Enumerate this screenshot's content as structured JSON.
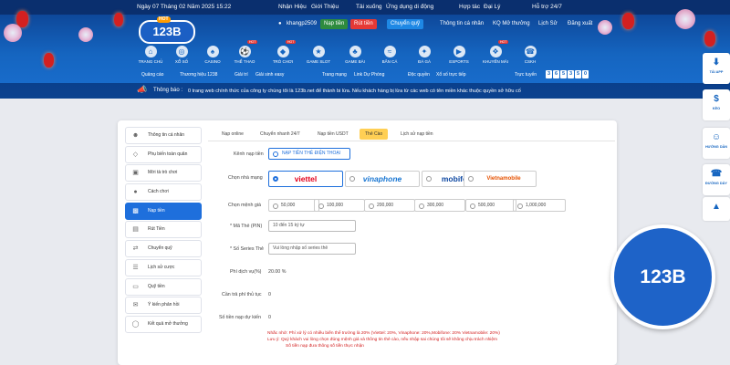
{
  "topbar": {
    "datetime": "Ngày 07 Tháng 02 Năm 2025 15:22",
    "links": [
      "Nhận Hiệu",
      "Giới Thiệu",
      "Tải xuống",
      "Ứng dụng di động",
      "Hợp tác",
      "Đại Lý",
      "Chăm",
      "Hỗ trợ 24/7"
    ]
  },
  "brand": {
    "logo_text": "123B",
    "logo_tag": "HOT"
  },
  "account": {
    "username": "khangp2509",
    "deposit_label": "Nạp tiền",
    "withdraw_label": "Rút tiền",
    "transfer_label": "Chuyển quỹ",
    "links": [
      "Thông tin cá nhân",
      "KQ Mở thưởng",
      "Lịch Sử",
      "Đăng xuất"
    ]
  },
  "nav": {
    "items": [
      {
        "label": "TRANG CHỦ",
        "icon": "home-icon"
      },
      {
        "label": "XỔ SỐ",
        "icon": "lottery-icon"
      },
      {
        "label": "CASINO",
        "icon": "casino-icon"
      },
      {
        "label": "THỂ THAO",
        "icon": "sports-icon",
        "hot": "HOT"
      },
      {
        "label": "TRÒ CHƠI",
        "icon": "game-icon",
        "hot": "HOT"
      },
      {
        "label": "GAME SLOT",
        "icon": "slot-icon"
      },
      {
        "label": "GAME BÀI",
        "icon": "card-icon"
      },
      {
        "label": "BẮN CÁ",
        "icon": "fish-icon"
      },
      {
        "label": "ĐÁ GÀ",
        "icon": "rooster-icon"
      },
      {
        "label": "ESPORTS",
        "icon": "esports-icon"
      },
      {
        "label": "KHUYẾN MÃI",
        "icon": "gift-icon",
        "hot": "HOT"
      },
      {
        "label": "CSKH",
        "icon": "support-icon"
      }
    ]
  },
  "subnav": {
    "items": [
      "Quảng cáo",
      "Thương hiệu 1238",
      "Giải trí",
      "Giải sinh easy",
      "Trang mạng",
      "Link Dự Phòng",
      "Độc quyền",
      "Xổ số trực tiếp"
    ],
    "online_label": "Trực tuyến",
    "online_digits": [
      "3",
      "6",
      "5",
      "3",
      "5",
      "0"
    ]
  },
  "notice": {
    "label": "Thông báo :",
    "text": "0 trang web chính thức của công ty chúng tôi là 123b.net để thành bi lừa. Nếu khách hàng bị lừa từ các web có tên miền khác thuộc quyền sở hữu cố"
  },
  "sidebar": {
    "items": [
      {
        "label": "Thông tin cá nhân",
        "icon": "user-icon"
      },
      {
        "label": "Phụ biến toàn quân",
        "icon": "diamond-icon"
      },
      {
        "label": "Mời tà trò chơi",
        "icon": "gamepad-icon"
      },
      {
        "label": "Cách chơi",
        "icon": "help-icon"
      },
      {
        "label": "Nạp tiền",
        "icon": "wallet-icon",
        "active": true
      },
      {
        "label": "Rút Tiền",
        "icon": "withdraw-icon"
      },
      {
        "label": "Chuyển quỹ",
        "icon": "transfer-icon"
      },
      {
        "label": "Lịch sử cược",
        "icon": "history-icon"
      },
      {
        "label": "Quỹ tiền",
        "icon": "fund-icon"
      },
      {
        "label": "Ý kiến phản hồi",
        "icon": "feedback-icon"
      },
      {
        "label": "Kết quả mở thưởng",
        "icon": "result-icon"
      }
    ]
  },
  "tabs": [
    "Nạp online",
    "Chuyển nhanh 24/7",
    "Nạp tiền USDT",
    "Thẻ Cào",
    "Lịch sử nạp tiền"
  ],
  "form": {
    "method_label": "Kênh nạp tiền",
    "method_value": "NẠP TIỀN THẺ ĐIỆN THOẠI",
    "carrier_label": "Chọn nhà mạng",
    "carriers": [
      "viettel",
      "vinaphone",
      "mobifone",
      "Vietnamobile"
    ],
    "amount_label": "Chọn mệnh giá",
    "amounts": [
      "50,000",
      "100,000",
      "200,000",
      "300,000",
      "500,000",
      "1,000,000"
    ],
    "pin_label": "* Mã Thẻ (PIN)",
    "pin_value": "10 đến 15 ký tự",
    "serial_label": "* Số Series Thẻ",
    "serial_placeholder": "Vui lòng nhập số series thẻ",
    "fee_label": "Phí dịch vụ(%)",
    "fee_value": "20.00 %",
    "payable_label": "Cần trả phí thủ tục",
    "payable_value": "0",
    "received_label": "Số tiền nạp dự kiến",
    "received_value": "0",
    "note_lines": [
      "Nhắc nhở: Phí xử lý có nhiều biến thể trường là 20% (Viettel: 20%, Vinaphone: 20%,Mobifone: 20% Vietnamobile: 20%)",
      "Lưu ý: Quý khách vui lòng chọn đúng mệnh giá và thông tin thẻ cào, nếu nhập sai chúng tôi sẽ không chịu trách nhiệm",
      "Số tiền nạp đưa thông số tiền thực nhận"
    ]
  },
  "rail": {
    "items": [
      {
        "label": "TẢI APP",
        "icon": "download-icon"
      },
      {
        "label": "KÈO",
        "icon": "money-icon"
      },
      {
        "label": "HƯỚNG DẪN",
        "icon": "guide-icon"
      },
      {
        "label": "ĐƯỜNG DÂY",
        "icon": "phone-icon"
      },
      {
        "label": "",
        "icon": "arrow-up-icon"
      }
    ]
  },
  "badge": {
    "logo_text": "123B"
  },
  "colors": {
    "primary": "#1565c0",
    "accent": "#ffcf54",
    "active": "#1e6fdc",
    "danger": "#d32020"
  }
}
